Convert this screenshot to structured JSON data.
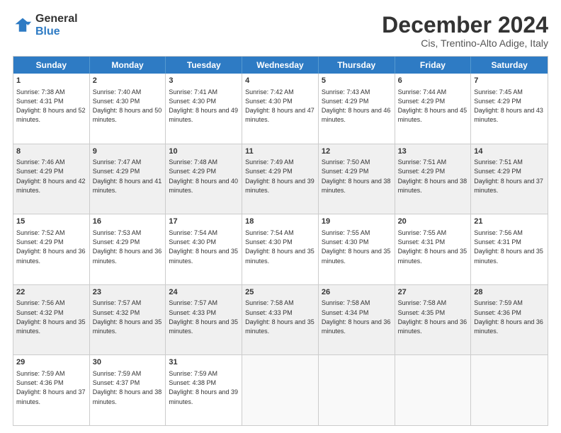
{
  "logo": {
    "general": "General",
    "blue": "Blue"
  },
  "title": "December 2024",
  "subtitle": "Cis, Trentino-Alto Adige, Italy",
  "days": [
    "Sunday",
    "Monday",
    "Tuesday",
    "Wednesday",
    "Thursday",
    "Friday",
    "Saturday"
  ],
  "weeks": [
    [
      {
        "day": "1",
        "sunrise": "7:38 AM",
        "sunset": "4:31 PM",
        "daylight": "8 hours and 52 minutes."
      },
      {
        "day": "2",
        "sunrise": "7:40 AM",
        "sunset": "4:30 PM",
        "daylight": "8 hours and 50 minutes."
      },
      {
        "day": "3",
        "sunrise": "7:41 AM",
        "sunset": "4:30 PM",
        "daylight": "8 hours and 49 minutes."
      },
      {
        "day": "4",
        "sunrise": "7:42 AM",
        "sunset": "4:30 PM",
        "daylight": "8 hours and 47 minutes."
      },
      {
        "day": "5",
        "sunrise": "7:43 AM",
        "sunset": "4:29 PM",
        "daylight": "8 hours and 46 minutes."
      },
      {
        "day": "6",
        "sunrise": "7:44 AM",
        "sunset": "4:29 PM",
        "daylight": "8 hours and 45 minutes."
      },
      {
        "day": "7",
        "sunrise": "7:45 AM",
        "sunset": "4:29 PM",
        "daylight": "8 hours and 43 minutes."
      }
    ],
    [
      {
        "day": "8",
        "sunrise": "7:46 AM",
        "sunset": "4:29 PM",
        "daylight": "8 hours and 42 minutes."
      },
      {
        "day": "9",
        "sunrise": "7:47 AM",
        "sunset": "4:29 PM",
        "daylight": "8 hours and 41 minutes."
      },
      {
        "day": "10",
        "sunrise": "7:48 AM",
        "sunset": "4:29 PM",
        "daylight": "8 hours and 40 minutes."
      },
      {
        "day": "11",
        "sunrise": "7:49 AM",
        "sunset": "4:29 PM",
        "daylight": "8 hours and 39 minutes."
      },
      {
        "day": "12",
        "sunrise": "7:50 AM",
        "sunset": "4:29 PM",
        "daylight": "8 hours and 38 minutes."
      },
      {
        "day": "13",
        "sunrise": "7:51 AM",
        "sunset": "4:29 PM",
        "daylight": "8 hours and 38 minutes."
      },
      {
        "day": "14",
        "sunrise": "7:51 AM",
        "sunset": "4:29 PM",
        "daylight": "8 hours and 37 minutes."
      }
    ],
    [
      {
        "day": "15",
        "sunrise": "7:52 AM",
        "sunset": "4:29 PM",
        "daylight": "8 hours and 36 minutes."
      },
      {
        "day": "16",
        "sunrise": "7:53 AM",
        "sunset": "4:29 PM",
        "daylight": "8 hours and 36 minutes."
      },
      {
        "day": "17",
        "sunrise": "7:54 AM",
        "sunset": "4:30 PM",
        "daylight": "8 hours and 35 minutes."
      },
      {
        "day": "18",
        "sunrise": "7:54 AM",
        "sunset": "4:30 PM",
        "daylight": "8 hours and 35 minutes."
      },
      {
        "day": "19",
        "sunrise": "7:55 AM",
        "sunset": "4:30 PM",
        "daylight": "8 hours and 35 minutes."
      },
      {
        "day": "20",
        "sunrise": "7:55 AM",
        "sunset": "4:31 PM",
        "daylight": "8 hours and 35 minutes."
      },
      {
        "day": "21",
        "sunrise": "7:56 AM",
        "sunset": "4:31 PM",
        "daylight": "8 hours and 35 minutes."
      }
    ],
    [
      {
        "day": "22",
        "sunrise": "7:56 AM",
        "sunset": "4:32 PM",
        "daylight": "8 hours and 35 minutes."
      },
      {
        "day": "23",
        "sunrise": "7:57 AM",
        "sunset": "4:32 PM",
        "daylight": "8 hours and 35 minutes."
      },
      {
        "day": "24",
        "sunrise": "7:57 AM",
        "sunset": "4:33 PM",
        "daylight": "8 hours and 35 minutes."
      },
      {
        "day": "25",
        "sunrise": "7:58 AM",
        "sunset": "4:33 PM",
        "daylight": "8 hours and 35 minutes."
      },
      {
        "day": "26",
        "sunrise": "7:58 AM",
        "sunset": "4:34 PM",
        "daylight": "8 hours and 36 minutes."
      },
      {
        "day": "27",
        "sunrise": "7:58 AM",
        "sunset": "4:35 PM",
        "daylight": "8 hours and 36 minutes."
      },
      {
        "day": "28",
        "sunrise": "7:59 AM",
        "sunset": "4:36 PM",
        "daylight": "8 hours and 36 minutes."
      }
    ],
    [
      {
        "day": "29",
        "sunrise": "7:59 AM",
        "sunset": "4:36 PM",
        "daylight": "8 hours and 37 minutes."
      },
      {
        "day": "30",
        "sunrise": "7:59 AM",
        "sunset": "4:37 PM",
        "daylight": "8 hours and 38 minutes."
      },
      {
        "day": "31",
        "sunrise": "7:59 AM",
        "sunset": "4:38 PM",
        "daylight": "8 hours and 39 minutes."
      },
      null,
      null,
      null,
      null
    ]
  ]
}
